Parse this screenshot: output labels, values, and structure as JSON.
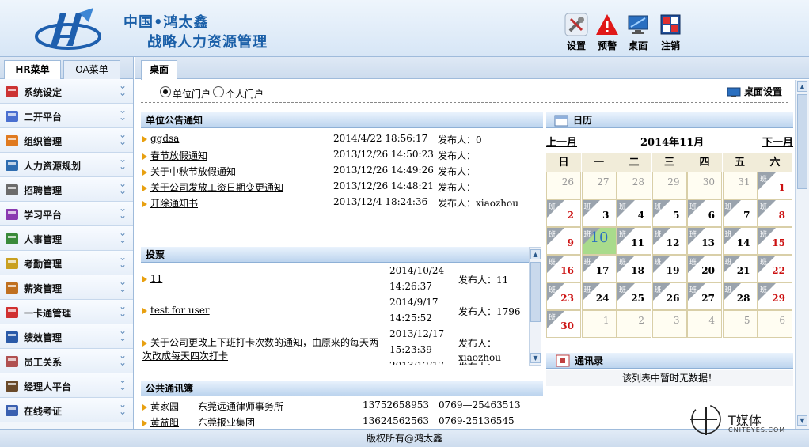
{
  "header": {
    "brand_line1": "中国•鸿太鑫",
    "brand_line2": "战略人力资源管理",
    "buttons": [
      {
        "label": "设置",
        "icon": "tools-icon"
      },
      {
        "label": "预警",
        "icon": "warning-icon"
      },
      {
        "label": "桌面",
        "icon": "monitor-icon"
      },
      {
        "label": "注销",
        "icon": "logout-icon"
      }
    ]
  },
  "sidebar": {
    "tabs": [
      {
        "label": "HR菜单",
        "active": true
      },
      {
        "label": "OA菜单",
        "active": false
      }
    ],
    "items": [
      {
        "label": "系统设定"
      },
      {
        "label": "二开平台"
      },
      {
        "label": "组织管理"
      },
      {
        "label": "人力资源规划"
      },
      {
        "label": "招聘管理"
      },
      {
        "label": "学习平台"
      },
      {
        "label": "人事管理"
      },
      {
        "label": "考勤管理"
      },
      {
        "label": "薪资管理"
      },
      {
        "label": "一卡通管理"
      },
      {
        "label": "绩效管理"
      },
      {
        "label": "员工关系"
      },
      {
        "label": "经理人平台"
      },
      {
        "label": "在线考证"
      }
    ]
  },
  "main": {
    "tab": "桌面",
    "portal": {
      "unit": "单位门户",
      "personal": "个人门户",
      "selected": "unit"
    },
    "desk_settings": "桌面设置",
    "notices": {
      "title": "单位公告通知",
      "rows": [
        {
          "title": "ggdsa",
          "time": "2014/4/22 18:56:17",
          "publisher": "发布人：0"
        },
        {
          "title": "春节放假通知",
          "time": "2013/12/26 14:50:23",
          "publisher": "发布人："
        },
        {
          "title": "关于中秋节放假通知",
          "time": "2013/12/26 14:49:26",
          "publisher": "发布人："
        },
        {
          "title": "关于公司发放工资日期变更通知",
          "time": "2013/12/26 14:48:21",
          "publisher": "发布人："
        },
        {
          "title": "开除通知书",
          "time": "2013/12/4 18:24:36",
          "publisher": "发布人：xiaozhou"
        }
      ]
    },
    "votes": {
      "title": "投票",
      "rows": [
        {
          "title": "11",
          "date": "2014/10/24",
          "clock": "14:26:37",
          "publisher": "发布人：11",
          "publisher2": ""
        },
        {
          "title": "test for user",
          "date": "2014/9/17",
          "clock": "14:25:52",
          "publisher": "发布人：1796",
          "publisher2": ""
        },
        {
          "title": "关于公司更改上下班打卡次数的通知，由原来的每天两次改成每天四次打卡",
          "date": "2013/12/17",
          "clock": "15:23:39",
          "publisher": "发布人：",
          "publisher2": "xiaozhou"
        }
      ],
      "partial_date": "2013/12/17",
      "partial_publisher": "发布人："
    },
    "contacts": {
      "title": "公共通讯簿",
      "rows": [
        {
          "name": "黄家园",
          "company": "东莞远通律师事务所",
          "mobile": "13752658953",
          "phone": "0769—25463513"
        },
        {
          "name": "黄益阳",
          "company": "东莞报业集团",
          "mobile": "13624562563",
          "phone": "0769-25136545"
        }
      ]
    },
    "calendar": {
      "title": "日历",
      "prev": "上一月",
      "next": "下一月",
      "month_label": "2014年11月",
      "weekdays": [
        "日",
        "一",
        "二",
        "三",
        "四",
        "五",
        "六"
      ],
      "shift_badge": "班",
      "today": "10",
      "weeks": [
        [
          "26",
          "27",
          "28",
          "29",
          "30",
          "31",
          "1"
        ],
        [
          "2",
          "3",
          "4",
          "5",
          "6",
          "7",
          "8"
        ],
        [
          "9",
          "10",
          "11",
          "12",
          "13",
          "14",
          "15"
        ],
        [
          "16",
          "17",
          "18",
          "19",
          "20",
          "21",
          "22"
        ],
        [
          "23",
          "24",
          "25",
          "26",
          "27",
          "28",
          "29"
        ],
        [
          "30",
          "1",
          "2",
          "3",
          "4",
          "5",
          "6"
        ]
      ]
    },
    "address_book": {
      "title": "通讯录",
      "empty_text": "该列表中暂时无数据！"
    }
  },
  "footer": {
    "copyright": "版权所有@鸿太鑫"
  },
  "watermark": {
    "text": "T媒体",
    "sub": "CNITEYES.COM"
  },
  "colors": {
    "brand_blue": "#1a5fa8",
    "header_bg": "#d7e6f6",
    "weekend_red": "#cc1111",
    "today_green": "#a9db8c",
    "badge_gray": "#9aa3ad"
  }
}
